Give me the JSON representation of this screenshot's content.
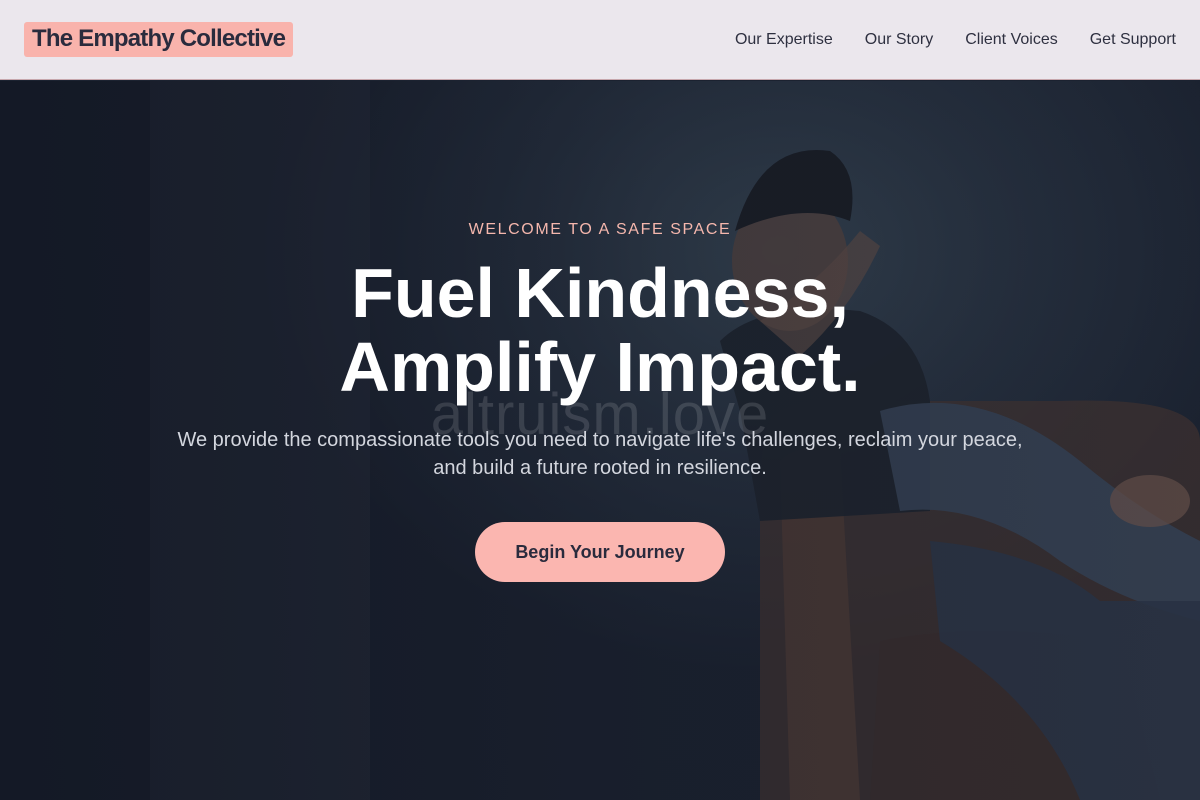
{
  "header": {
    "logo": "The Empathy Collective",
    "nav": [
      {
        "label": "Our Expertise"
      },
      {
        "label": "Our Story"
      },
      {
        "label": "Client Voices"
      },
      {
        "label": "Get Support"
      }
    ]
  },
  "hero": {
    "eyebrow": "WELCOME TO A SAFE SPACE",
    "headline_line1": "Fuel Kindness,",
    "headline_line2": "Amplify Impact.",
    "subtext_line1": "We provide the compassionate tools you need to navigate life's challenges, reclaim your peace,",
    "subtext_line2": "and build a future rooted in resilience.",
    "cta_label": "Begin Your Journey",
    "watermark": "altruism.love"
  },
  "colors": {
    "accent": "#fbb6b0",
    "header_bg": "#ebe7ed",
    "hero_bg": "#1b2230",
    "eyebrow": "#f5b7ad"
  }
}
